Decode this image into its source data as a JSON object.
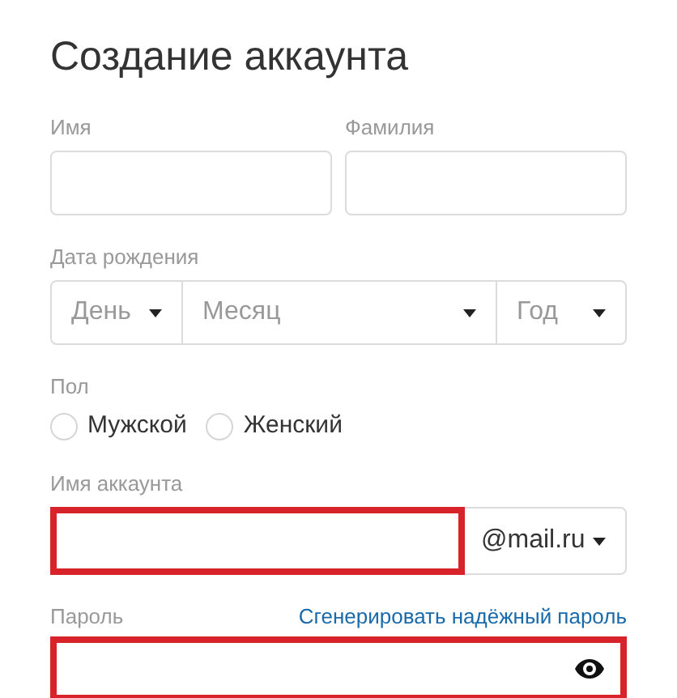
{
  "title": "Создание аккаунта",
  "name_fields": [
    {
      "label": "Имя",
      "error": false
    },
    {
      "label": "Фамилия",
      "error": false
    }
  ],
  "birth_date": {
    "label": "Дата рождения",
    "selects": [
      {
        "placeholder": "День"
      },
      {
        "placeholder": "Месяц"
      },
      {
        "placeholder": "Год"
      }
    ]
  },
  "gender": {
    "label": "Пол",
    "options": [
      {
        "label": "Мужской",
        "selected": false
      },
      {
        "label": "Женский",
        "selected": false
      }
    ]
  },
  "account": {
    "label": "Имя аккаунта",
    "error": true,
    "domain": "@mail.ru"
  },
  "password": {
    "label": "Пароль",
    "generate_link": "Сгенерировать надёжный пароль",
    "error": true
  }
}
